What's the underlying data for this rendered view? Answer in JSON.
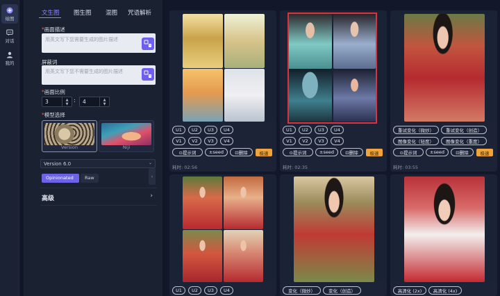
{
  "rail": {
    "items": [
      {
        "label": "绘图"
      },
      {
        "label": "对话"
      },
      {
        "label": "我的"
      }
    ]
  },
  "tabs": [
    "文生图",
    "图生图",
    "混图",
    "咒语解析"
  ],
  "form": {
    "prompt_label": "画面描述",
    "prompt_placeholder": "用英文写下您需要生成的图片描述",
    "neg_label": "屏蔽词",
    "neg_placeholder": "用英文写下您不需要生成的图片描述",
    "ratio_label": "画面比例",
    "ratio_w": "3",
    "ratio_h": "4",
    "model_label": "模型选择",
    "models": [
      "Version",
      "Niji"
    ],
    "version": "Version 6.0",
    "style_modes": [
      "Opinionated",
      "Raw"
    ],
    "advanced": "高级"
  },
  "cards": [
    {
      "buttons_row1": [
        "U1",
        "U2",
        "U3",
        "U4"
      ],
      "buttons_row2": [
        "V1",
        "V2",
        "V3",
        "V4"
      ],
      "actions": [
        "⊙提示词",
        "±seed",
        "⊡删除"
      ],
      "tag": "极速",
      "time": "耗时: 02:56"
    },
    {
      "buttons_row1": [
        "U1",
        "U2",
        "U3",
        "U4"
      ],
      "buttons_row2": [
        "V1",
        "V2",
        "V3",
        "V4"
      ],
      "actions": [
        "⊙提示词",
        "±seed",
        "⊡删除"
      ],
      "tag": "极速",
      "time": "耗时: 02:35"
    },
    {
      "buttons_row1": [
        "重试变化（微妙）",
        "重试变化（创造）"
      ],
      "buttons_row2": [
        "图像变化（轻度）",
        "图像变化（重度）"
      ],
      "actions": [
        "⊙提示词",
        "±seed",
        "⊡删除"
      ],
      "tag": "极速",
      "time": "耗时: 03:55"
    },
    {
      "buttons_row1": [
        "U1",
        "U2",
        "U3",
        "U4"
      ]
    },
    {
      "buttons_row1": [
        "变化（微妙）",
        "变化（创造）"
      ]
    },
    {
      "buttons_row1": [
        "高清化 (2x)",
        "高清化 (4x)"
      ]
    }
  ],
  "colors": {
    "accent": "#6f5ff0",
    "tab_active": "#8f86ff",
    "tag": "#f0a43a",
    "selection": "#e0323c"
  }
}
